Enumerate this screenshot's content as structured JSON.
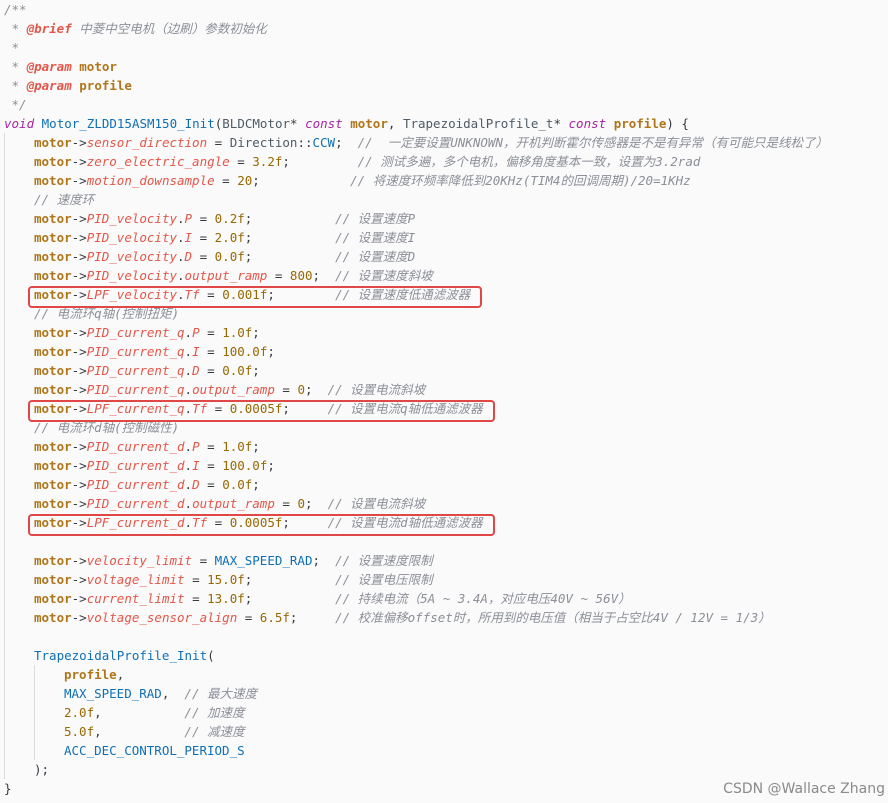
{
  "editor": {
    "lines": [
      {
        "indent": 0,
        "segs": [
          [
            "/**",
            "cm"
          ]
        ]
      },
      {
        "indent": 0,
        "segs": [
          [
            " * ",
            "cm"
          ],
          [
            "@brief",
            "cmtag"
          ],
          [
            " 中菱中空电机（边刷）参数初始化",
            "cm"
          ]
        ]
      },
      {
        "indent": 0,
        "segs": [
          [
            " *",
            "cm"
          ]
        ]
      },
      {
        "indent": 0,
        "segs": [
          [
            " * ",
            "cm"
          ],
          [
            "@param",
            "cmtag"
          ],
          [
            " ",
            "cm"
          ],
          [
            "motor",
            "param"
          ]
        ]
      },
      {
        "indent": 0,
        "segs": [
          [
            " * ",
            "cm"
          ],
          [
            "@param",
            "cmtag"
          ],
          [
            " ",
            "cm"
          ],
          [
            "profile",
            "param"
          ]
        ]
      },
      {
        "indent": 0,
        "segs": [
          [
            " */",
            "cm"
          ]
        ]
      },
      {
        "indent": 0,
        "segs": [
          [
            "void",
            "kw"
          ],
          [
            " ",
            "op"
          ],
          [
            "Motor_ZLDD15ASM150_Init",
            "fn"
          ],
          [
            "(",
            "op"
          ],
          [
            "BLDCMotor",
            "type"
          ],
          [
            "*",
            "op"
          ],
          [
            " ",
            "op"
          ],
          [
            "const",
            "kw"
          ],
          [
            " ",
            "op"
          ],
          [
            "motor",
            "param"
          ],
          [
            ", ",
            "op"
          ],
          [
            "TrapezoidalProfile_t",
            "type"
          ],
          [
            "*",
            "op"
          ],
          [
            " ",
            "op"
          ],
          [
            "const",
            "kw"
          ],
          [
            " ",
            "op"
          ],
          [
            "profile",
            "param"
          ],
          [
            ") {",
            "op"
          ]
        ]
      },
      {
        "indent": 1,
        "segs": [
          [
            "motor",
            "param"
          ],
          [
            "->",
            "op"
          ],
          [
            "sensor_direction",
            "member"
          ],
          [
            " = ",
            "op"
          ],
          [
            "Direction",
            "type"
          ],
          [
            "::",
            "op"
          ],
          [
            "CCW",
            "ident"
          ],
          [
            ";  ",
            "op"
          ],
          [
            "//  一定要设置UNKNOWN，开机判断霍尔传感器是不是有异常（有可能只是线松了）",
            "cm"
          ]
        ]
      },
      {
        "indent": 1,
        "segs": [
          [
            "motor",
            "param"
          ],
          [
            "->",
            "op"
          ],
          [
            "zero_electric_angle",
            "member"
          ],
          [
            " = ",
            "op"
          ],
          [
            "3.2f",
            "num"
          ],
          [
            ";         ",
            "op"
          ],
          [
            "// 测试多遍，多个电机，偏移角度基本一致，设置为3.2rad",
            "cm"
          ]
        ]
      },
      {
        "indent": 1,
        "segs": [
          [
            "motor",
            "param"
          ],
          [
            "->",
            "op"
          ],
          [
            "motion_downsample",
            "member"
          ],
          [
            " = ",
            "op"
          ],
          [
            "20",
            "num"
          ],
          [
            ";            ",
            "op"
          ],
          [
            "// 将速度环频率降低到20KHz(TIM4的回调周期)/20=1KHz",
            "cm"
          ]
        ]
      },
      {
        "indent": 1,
        "segs": [
          [
            "// 速度环",
            "cm"
          ]
        ]
      },
      {
        "indent": 1,
        "segs": [
          [
            "motor",
            "param"
          ],
          [
            "->",
            "op"
          ],
          [
            "PID_velocity",
            "member"
          ],
          [
            ".",
            "op"
          ],
          [
            "P",
            "member"
          ],
          [
            " = ",
            "op"
          ],
          [
            "0.2f",
            "num"
          ],
          [
            ";           ",
            "op"
          ],
          [
            "// 设置速度P",
            "cm"
          ]
        ]
      },
      {
        "indent": 1,
        "segs": [
          [
            "motor",
            "param"
          ],
          [
            "->",
            "op"
          ],
          [
            "PID_velocity",
            "member"
          ],
          [
            ".",
            "op"
          ],
          [
            "I",
            "member"
          ],
          [
            " = ",
            "op"
          ],
          [
            "2.0f",
            "num"
          ],
          [
            ";           ",
            "op"
          ],
          [
            "// 设置速度I",
            "cm"
          ]
        ]
      },
      {
        "indent": 1,
        "segs": [
          [
            "motor",
            "param"
          ],
          [
            "->",
            "op"
          ],
          [
            "PID_velocity",
            "member"
          ],
          [
            ".",
            "op"
          ],
          [
            "D",
            "member"
          ],
          [
            " = ",
            "op"
          ],
          [
            "0.0f",
            "num"
          ],
          [
            ";           ",
            "op"
          ],
          [
            "// 设置速度D",
            "cm"
          ]
        ]
      },
      {
        "indent": 1,
        "segs": [
          [
            "motor",
            "param"
          ],
          [
            "->",
            "op"
          ],
          [
            "PID_velocity",
            "member"
          ],
          [
            ".",
            "op"
          ],
          [
            "output_ramp",
            "member"
          ],
          [
            " = ",
            "op"
          ],
          [
            "800",
            "num"
          ],
          [
            ";  ",
            "op"
          ],
          [
            "// 设置速度斜坡",
            "cm"
          ]
        ]
      },
      {
        "indent": 1,
        "segs": [
          [
            "motor",
            "param"
          ],
          [
            "->",
            "op"
          ],
          [
            "LPF_velocity",
            "member"
          ],
          [
            ".",
            "op"
          ],
          [
            "Tf",
            "member"
          ],
          [
            " = ",
            "op"
          ],
          [
            "0.001f",
            "num"
          ],
          [
            ";        ",
            "op"
          ],
          [
            "// 设置速度低通滤波器",
            "cm"
          ]
        ]
      },
      {
        "indent": 1,
        "segs": [
          [
            "// 电流环q轴(控制扭矩)",
            "cm"
          ]
        ]
      },
      {
        "indent": 1,
        "segs": [
          [
            "motor",
            "param"
          ],
          [
            "->",
            "op"
          ],
          [
            "PID_current_q",
            "member"
          ],
          [
            ".",
            "op"
          ],
          [
            "P",
            "member"
          ],
          [
            " = ",
            "op"
          ],
          [
            "1.0f",
            "num"
          ],
          [
            ";",
            "op"
          ]
        ]
      },
      {
        "indent": 1,
        "segs": [
          [
            "motor",
            "param"
          ],
          [
            "->",
            "op"
          ],
          [
            "PID_current_q",
            "member"
          ],
          [
            ".",
            "op"
          ],
          [
            "I",
            "member"
          ],
          [
            " = ",
            "op"
          ],
          [
            "100.0f",
            "num"
          ],
          [
            ";",
            "op"
          ]
        ]
      },
      {
        "indent": 1,
        "segs": [
          [
            "motor",
            "param"
          ],
          [
            "->",
            "op"
          ],
          [
            "PID_current_q",
            "member"
          ],
          [
            ".",
            "op"
          ],
          [
            "D",
            "member"
          ],
          [
            " = ",
            "op"
          ],
          [
            "0.0f",
            "num"
          ],
          [
            ";",
            "op"
          ]
        ]
      },
      {
        "indent": 1,
        "segs": [
          [
            "motor",
            "param"
          ],
          [
            "->",
            "op"
          ],
          [
            "PID_current_q",
            "member"
          ],
          [
            ".",
            "op"
          ],
          [
            "output_ramp",
            "member"
          ],
          [
            " = ",
            "op"
          ],
          [
            "0",
            "num"
          ],
          [
            ";  ",
            "op"
          ],
          [
            "// 设置电流斜坡",
            "cm"
          ]
        ]
      },
      {
        "indent": 1,
        "segs": [
          [
            "motor",
            "param"
          ],
          [
            "->",
            "op"
          ],
          [
            "LPF_current_q",
            "member"
          ],
          [
            ".",
            "op"
          ],
          [
            "Tf",
            "member"
          ],
          [
            " = ",
            "op"
          ],
          [
            "0.0005f",
            "num"
          ],
          [
            ";     ",
            "op"
          ],
          [
            "// 设置电流q轴低通滤波器",
            "cm"
          ]
        ]
      },
      {
        "indent": 1,
        "segs": [
          [
            "// 电流环d轴(控制磁性)",
            "cm"
          ]
        ]
      },
      {
        "indent": 1,
        "segs": [
          [
            "motor",
            "param"
          ],
          [
            "->",
            "op"
          ],
          [
            "PID_current_d",
            "member"
          ],
          [
            ".",
            "op"
          ],
          [
            "P",
            "member"
          ],
          [
            " = ",
            "op"
          ],
          [
            "1.0f",
            "num"
          ],
          [
            ";",
            "op"
          ]
        ]
      },
      {
        "indent": 1,
        "segs": [
          [
            "motor",
            "param"
          ],
          [
            "->",
            "op"
          ],
          [
            "PID_current_d",
            "member"
          ],
          [
            ".",
            "op"
          ],
          [
            "I",
            "member"
          ],
          [
            " = ",
            "op"
          ],
          [
            "100.0f",
            "num"
          ],
          [
            ";",
            "op"
          ]
        ]
      },
      {
        "indent": 1,
        "segs": [
          [
            "motor",
            "param"
          ],
          [
            "->",
            "op"
          ],
          [
            "PID_current_d",
            "member"
          ],
          [
            ".",
            "op"
          ],
          [
            "D",
            "member"
          ],
          [
            " = ",
            "op"
          ],
          [
            "0.0f",
            "num"
          ],
          [
            ";",
            "op"
          ]
        ]
      },
      {
        "indent": 1,
        "segs": [
          [
            "motor",
            "param"
          ],
          [
            "->",
            "op"
          ],
          [
            "PID_current_d",
            "member"
          ],
          [
            ".",
            "op"
          ],
          [
            "output_ramp",
            "member"
          ],
          [
            " = ",
            "op"
          ],
          [
            "0",
            "num"
          ],
          [
            ";  ",
            "op"
          ],
          [
            "// 设置电流斜坡",
            "cm"
          ]
        ]
      },
      {
        "indent": 1,
        "segs": [
          [
            "motor",
            "param"
          ],
          [
            "->",
            "op"
          ],
          [
            "LPF_current_d",
            "member"
          ],
          [
            ".",
            "op"
          ],
          [
            "Tf",
            "member"
          ],
          [
            " = ",
            "op"
          ],
          [
            "0.0005f",
            "num"
          ],
          [
            ";     ",
            "op"
          ],
          [
            "// 设置电流d轴低通滤波器",
            "cm"
          ]
        ]
      },
      {
        "indent": 1,
        "segs": []
      },
      {
        "indent": 1,
        "segs": [
          [
            "motor",
            "param"
          ],
          [
            "->",
            "op"
          ],
          [
            "velocity_limit",
            "member"
          ],
          [
            " = ",
            "op"
          ],
          [
            "MAX_SPEED_RAD",
            "ident"
          ],
          [
            ";  ",
            "op"
          ],
          [
            "// 设置速度限制",
            "cm"
          ]
        ]
      },
      {
        "indent": 1,
        "segs": [
          [
            "motor",
            "param"
          ],
          [
            "->",
            "op"
          ],
          [
            "voltage_limit",
            "member"
          ],
          [
            " = ",
            "op"
          ],
          [
            "15.0f",
            "num"
          ],
          [
            ";           ",
            "op"
          ],
          [
            "// 设置电压限制",
            "cm"
          ]
        ]
      },
      {
        "indent": 1,
        "segs": [
          [
            "motor",
            "param"
          ],
          [
            "->",
            "op"
          ],
          [
            "current_limit",
            "member"
          ],
          [
            " = ",
            "op"
          ],
          [
            "13.0f",
            "num"
          ],
          [
            ";           ",
            "op"
          ],
          [
            "// 持续电流（5A ~ 3.4A，对应电压40V ~ 56V）",
            "cm"
          ]
        ]
      },
      {
        "indent": 1,
        "segs": [
          [
            "motor",
            "param"
          ],
          [
            "->",
            "op"
          ],
          [
            "voltage_sensor_align",
            "member"
          ],
          [
            " = ",
            "op"
          ],
          [
            "6.5f",
            "num"
          ],
          [
            ";     ",
            "op"
          ],
          [
            "// 校准偏移offset时，所用到的电压值（相当于占空比4V / 12V = 1/3）",
            "cm"
          ]
        ]
      },
      {
        "indent": 1,
        "segs": []
      },
      {
        "indent": 1,
        "segs": [
          [
            "TrapezoidalProfile_Init",
            "fn"
          ],
          [
            "(",
            "op"
          ]
        ]
      },
      {
        "indent": 2,
        "segs": [
          [
            "profile",
            "param"
          ],
          [
            ",",
            "op"
          ]
        ]
      },
      {
        "indent": 2,
        "segs": [
          [
            "MAX_SPEED_RAD",
            "ident"
          ],
          [
            ",  ",
            "op"
          ],
          [
            "// 最大速度",
            "cm"
          ]
        ]
      },
      {
        "indent": 2,
        "segs": [
          [
            "2.0f",
            "num"
          ],
          [
            ",           ",
            "op"
          ],
          [
            "// 加速度",
            "cm"
          ]
        ]
      },
      {
        "indent": 2,
        "segs": [
          [
            "5.0f",
            "num"
          ],
          [
            ",           ",
            "op"
          ],
          [
            "// 减速度",
            "cm"
          ]
        ]
      },
      {
        "indent": 2,
        "segs": [
          [
            "ACC_DEC_CONTROL_PERIOD_S",
            "ident"
          ]
        ]
      },
      {
        "indent": 1,
        "segs": [
          [
            ");",
            "op"
          ]
        ]
      },
      {
        "indent": 0,
        "segs": [
          [
            "}",
            "op"
          ]
        ]
      }
    ]
  },
  "highlights": [
    {
      "line": 15,
      "label": "lpf-velocity"
    },
    {
      "line": 21,
      "label": "lpf-current-q"
    },
    {
      "line": 27,
      "label": "lpf-current-d"
    }
  ],
  "watermark": "CSDN @Wallace Zhang",
  "colors": {
    "background": "#fafafa",
    "highlight_border": "#e04747"
  }
}
